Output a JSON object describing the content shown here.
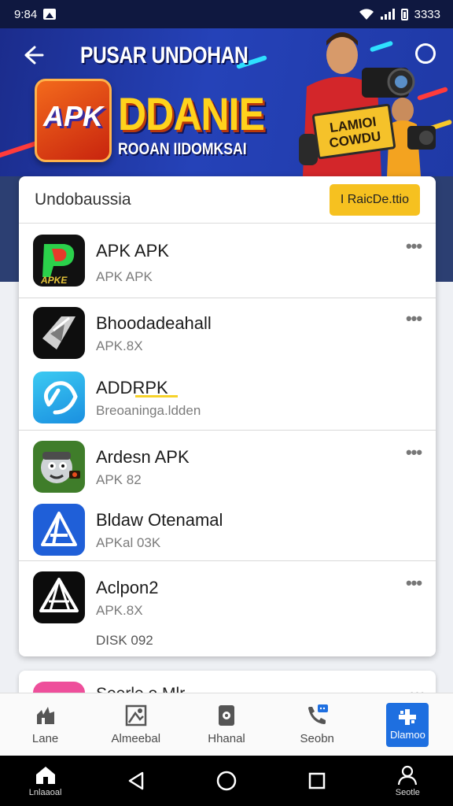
{
  "status_bar": {
    "time": "9:84",
    "battery_text": "3333"
  },
  "banner": {
    "heading": "PUSAR UNDOHAN",
    "logo_text": "APK",
    "brand": "DDANIE",
    "subtitle": "ROOAN IIDOMKSAI",
    "sign_text": "LAMIOI\nCOWDU"
  },
  "card": {
    "title": "Undobaussia",
    "cta_label": "I RaicDe.ttio",
    "items": [
      {
        "name": "APK APK",
        "meta": "APK APK"
      },
      {
        "name": "Bhoodadeahall",
        "meta": "APK.8X"
      },
      {
        "name": "ADDRPK",
        "meta": "Breoaninga.ldden"
      },
      {
        "name": "Ardesn APK",
        "meta": "APK 82"
      },
      {
        "name": "Bldaw Otenamal",
        "meta": "APKal 03K"
      },
      {
        "name": "Aclpon2",
        "meta": "APK.8X"
      }
    ],
    "disk": "DISK 092"
  },
  "card2": {
    "name": "Seerle o Mlr"
  },
  "tabs": [
    {
      "label": "Lane",
      "icon": "category-icon"
    },
    {
      "label": "Almeebal",
      "icon": "image-icon"
    },
    {
      "label": "Hhanal",
      "icon": "phone-icon"
    },
    {
      "label": "Seobn",
      "icon": "call-chat-icon"
    },
    {
      "label": "Dlamoo",
      "icon": "grid-icon"
    }
  ],
  "nav": {
    "home_label": "Lnlaaoal",
    "profile_label": "Seotle"
  },
  "colors": {
    "banner": "#2542b8",
    "accent_yellow": "#f6c120",
    "active_tab": "#1e6fe0"
  }
}
